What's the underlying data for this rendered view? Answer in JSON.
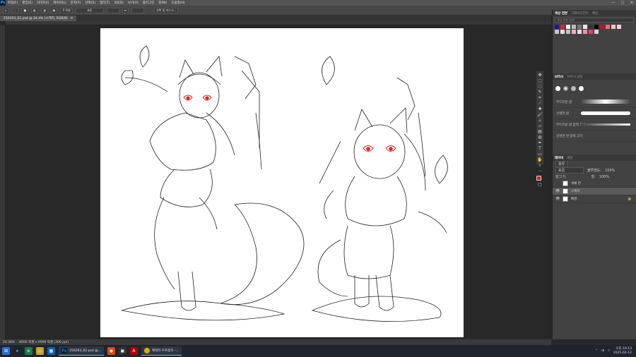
{
  "menubar": {
    "logo": "Ps",
    "items": [
      "파일(F)",
      "편집(E)",
      "이미지(I)",
      "레이어(L)",
      "문자(Y)",
      "선택(S)",
      "필터(T)",
      "3D(D)",
      "보기(V)",
      "플러그인",
      "창(W)",
      "도움말(H)"
    ],
    "minimize": "—",
    "maximize": "▢",
    "close": "✕"
  },
  "options": {
    "tool_label": "새 선택",
    "feather": "0 픽셀",
    "style": "표준",
    "select_mask": "선택 및 마스크..."
  },
  "document": {
    "tab_title": "250203_02.psd @ 24.4% (스케치, RGB/8)",
    "tab_close": "✕",
    "zoom": "24.38%",
    "doc_size": "8000 픽셀 x 6906 픽셀 (300 ppi)"
  },
  "panels": {
    "color_tabs": [
      "색상 견본",
      "그레이디언트",
      "패턴"
    ],
    "swatch_search": "색상 견본 검색",
    "swatch_colors": [
      "#1a1aa8",
      "#e0202c",
      "#ffffff",
      "#bbbbbb",
      "#777777",
      "#e8e8e8",
      "#333333",
      "#000000",
      "#c8102e",
      "#ff6666",
      "#f0c0c8",
      "#f8d0d8",
      "#d0c0d0",
      "#e0e0e0",
      "#c0c0c0",
      "#f4b0b8",
      "#fcd8e0",
      "#f090a0",
      "#e84060",
      "#d0d8e0"
    ],
    "brush_tabs": [
      "브러시",
      "브러시 설정"
    ],
    "brushes": [
      {
        "label": "부드러운 원"
      },
      {
        "label": "선명한 원"
      },
      {
        "label": "부드러운 원 압력 크기"
      },
      {
        "label": "선명한 원 압력 크기"
      }
    ],
    "layer_tabs": [
      "레이어",
      "채널"
    ],
    "layer_kind": "종류",
    "blend_mode": "표준",
    "opacity_label": "불투명도:",
    "opacity": "100%",
    "lock_label": "잠그기:",
    "fill_label": "칠:",
    "fill": "100%",
    "layers": [
      {
        "name": "색채 면",
        "visible": false,
        "selected": false
      },
      {
        "name": "스케치",
        "visible": true,
        "selected": true
      },
      {
        "name": "배경",
        "visible": true,
        "selected": false
      }
    ],
    "fg_color": "#e81e1e",
    "bg_color": "#1e3ce8"
  },
  "taskbar": {
    "apps": [
      {
        "label": "250203_02.psd @..."
      },
      {
        "label": "캐릭터 우프송자 -..."
      }
    ],
    "time": "오후 10:13",
    "date": "2025-02-12"
  }
}
